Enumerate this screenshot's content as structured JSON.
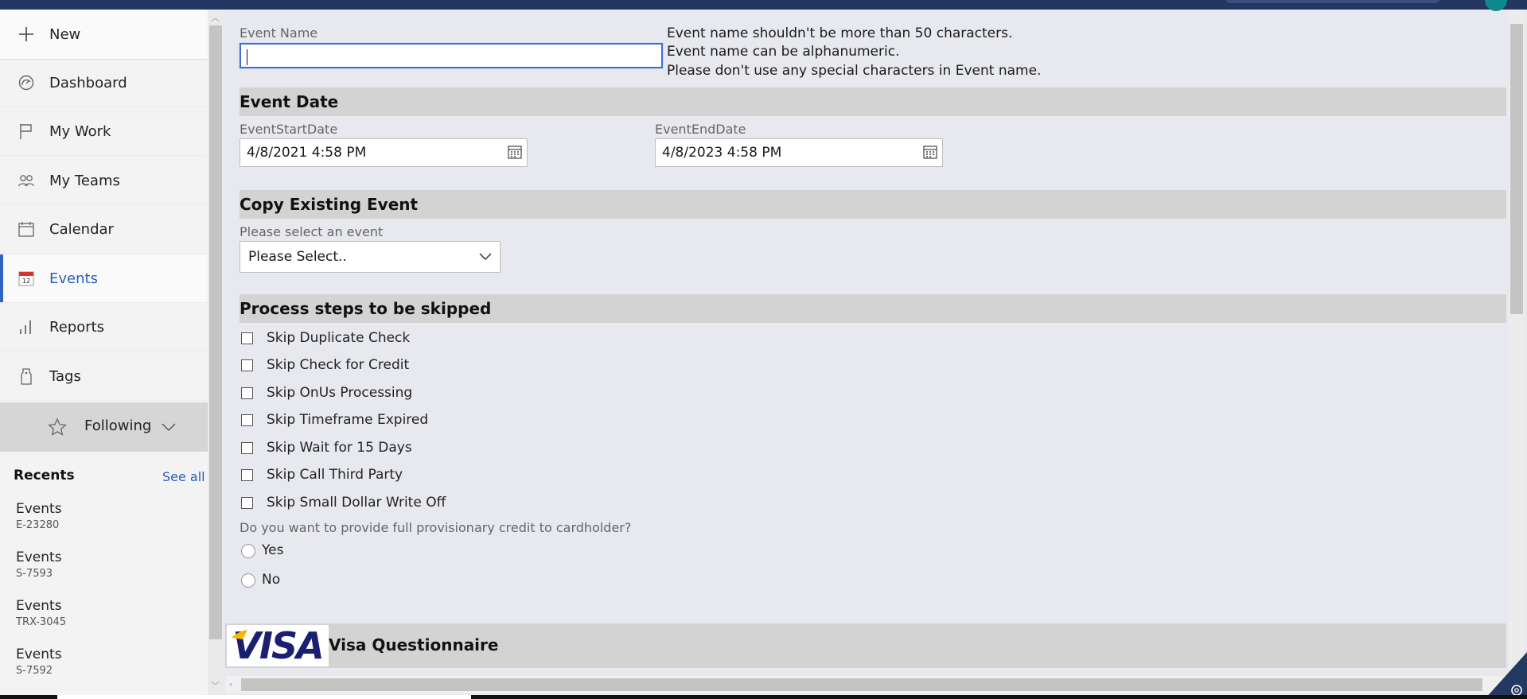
{
  "sidebar": {
    "new_label": "New",
    "items": [
      {
        "label": "Dashboard",
        "icon": "dashboard-icon"
      },
      {
        "label": "My Work",
        "icon": "flag-icon"
      },
      {
        "label": "My Teams",
        "icon": "people-icon"
      },
      {
        "label": "Calendar",
        "icon": "calendar-icon"
      },
      {
        "label": "Events",
        "icon": "event-calendar-icon",
        "active": true
      },
      {
        "label": "Reports",
        "icon": "bar-chart-icon"
      },
      {
        "label": "Tags",
        "icon": "tag-icon"
      }
    ],
    "following_label": "Following",
    "recents_title": "Recents",
    "see_all": "See all",
    "recents": [
      {
        "title": "Events",
        "sub": "E-23280"
      },
      {
        "title": "Events",
        "sub": "S-7593"
      },
      {
        "title": "Events",
        "sub": "TRX-3045"
      },
      {
        "title": "Events",
        "sub": "S-7592"
      }
    ]
  },
  "form": {
    "event_name_label": "Event Name",
    "event_name_value": "",
    "hints": [
      "Event name shouldn't be more than 50 characters.",
      "Event name can be alphanumeric.",
      "Please don't use any special characters in Event name."
    ],
    "event_date_heading": "Event Date",
    "start_label": "EventStartDate",
    "start_value": "4/8/2021 4:58 PM",
    "end_label": "EventEndDate",
    "end_value": "4/8/2023 4:58 PM",
    "copy_heading": "Copy Existing Event",
    "select_label": "Please select an event",
    "select_value": "Please Select..",
    "skip_heading": "Process steps to be skipped",
    "checkboxes": [
      "Skip Duplicate Check",
      "Skip Check for Credit",
      "Skip OnUs Processing",
      "Skip Timeframe Expired",
      "Skip Wait for 15 Days",
      "Skip Call Third Party",
      "Skip Small Dollar Write Off"
    ],
    "credit_question": "Do you want to provide full provisionary credit to cardholder?",
    "radio_yes": "Yes",
    "radio_no": "No",
    "visa_logo_text": "VISA",
    "visa_title": "Visa Questionnaire"
  },
  "colors": {
    "accent": "#2f63c4",
    "topbar": "#233760",
    "visa_blue": "#1a1f71",
    "visa_gold": "#f7b600"
  }
}
